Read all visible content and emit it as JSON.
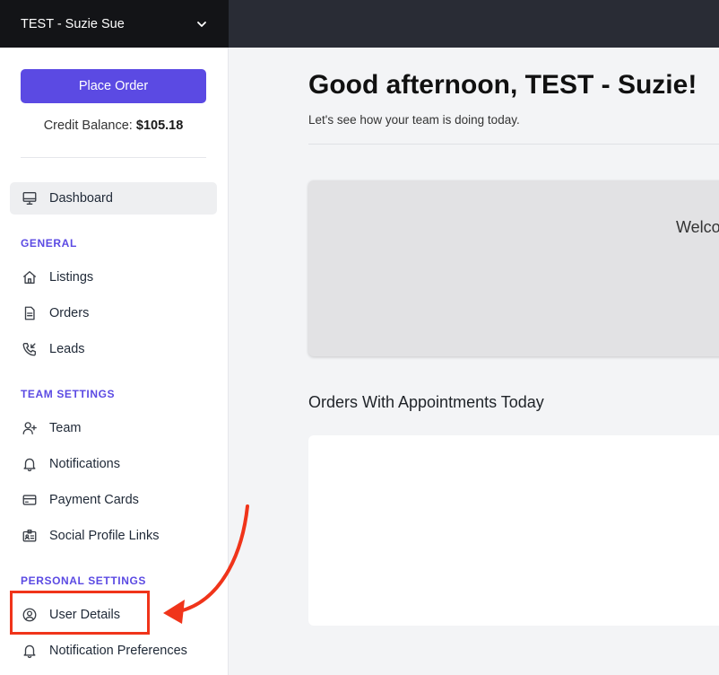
{
  "account": {
    "name": "TEST - Suzie Sue",
    "icon": "chevron-down-icon"
  },
  "sidebar": {
    "place_order_label": "Place Order",
    "credit_label": "Credit Balance:",
    "credit_value": "$105.18",
    "dashboard": {
      "label": "Dashboard",
      "icon": "monitor-icon"
    },
    "sections": [
      {
        "title": "GENERAL",
        "items": [
          {
            "label": "Listings",
            "icon": "home-icon"
          },
          {
            "label": "Orders",
            "icon": "document-icon"
          },
          {
            "label": "Leads",
            "icon": "phone-incoming-icon"
          }
        ]
      },
      {
        "title": "TEAM SETTINGS",
        "items": [
          {
            "label": "Team",
            "icon": "user-plus-icon"
          },
          {
            "label": "Notifications",
            "icon": "bell-icon"
          },
          {
            "label": "Payment Cards",
            "icon": "credit-card-icon"
          },
          {
            "label": "Social Profile Links",
            "icon": "id-card-icon"
          }
        ]
      },
      {
        "title": "PERSONAL SETTINGS",
        "items": [
          {
            "label": "User Details",
            "icon": "user-circle-icon"
          },
          {
            "label": "Notification Preferences",
            "icon": "bell-icon"
          }
        ]
      }
    ]
  },
  "main": {
    "greeting": "Good afternoon, TEST - Suzie!",
    "subtitle": "Let's see how your team is doing today.",
    "welcome_text": "Welco",
    "orders_title": "Orders With Appointments Today"
  },
  "colors": {
    "accent": "#5b4ae3",
    "annotation": "#f0341a",
    "topbar": "#292c35"
  }
}
